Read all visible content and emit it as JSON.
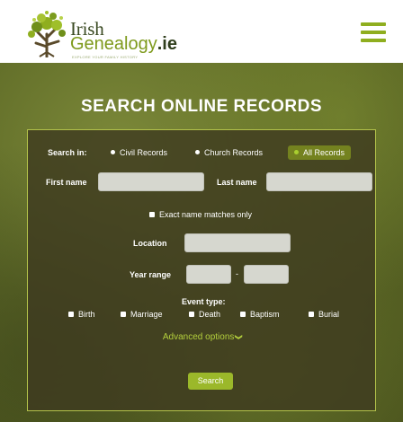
{
  "header": {
    "logo_word_1": "Irish",
    "logo_word_2": "Genealogy",
    "logo_suffix": ".ie",
    "logo_tagline": "EXPLORE YOUR FAMILY HISTORY",
    "menu_icon": "hamburger-menu-icon"
  },
  "colors": {
    "brand_green": "#8fae1f",
    "button_green": "#9bb82a",
    "panel_bg": "#3e3a20",
    "panel_border": "#b3c24a"
  },
  "hero": {
    "title": "SEARCH ONLINE RECORDS"
  },
  "form": {
    "search_in_label": "Search in:",
    "record_types": [
      {
        "label": "Civil Records",
        "selected": false
      },
      {
        "label": "Church Records",
        "selected": false
      },
      {
        "label": "All Records",
        "selected": true
      }
    ],
    "first_name_label": "First name",
    "first_name_value": "",
    "last_name_label": "Last name",
    "last_name_value": "",
    "exact_match_label": "Exact name matches only",
    "location_label": "Location",
    "location_value": "",
    "year_range_label": "Year range",
    "year_from_value": "",
    "year_to_value": "",
    "year_separator": "-",
    "event_type_label": "Event type:",
    "event_types": [
      "Birth",
      "Marriage",
      "Death",
      "Baptism",
      "Burial"
    ],
    "advanced_label": "Advanced options",
    "search_button": "Search"
  }
}
